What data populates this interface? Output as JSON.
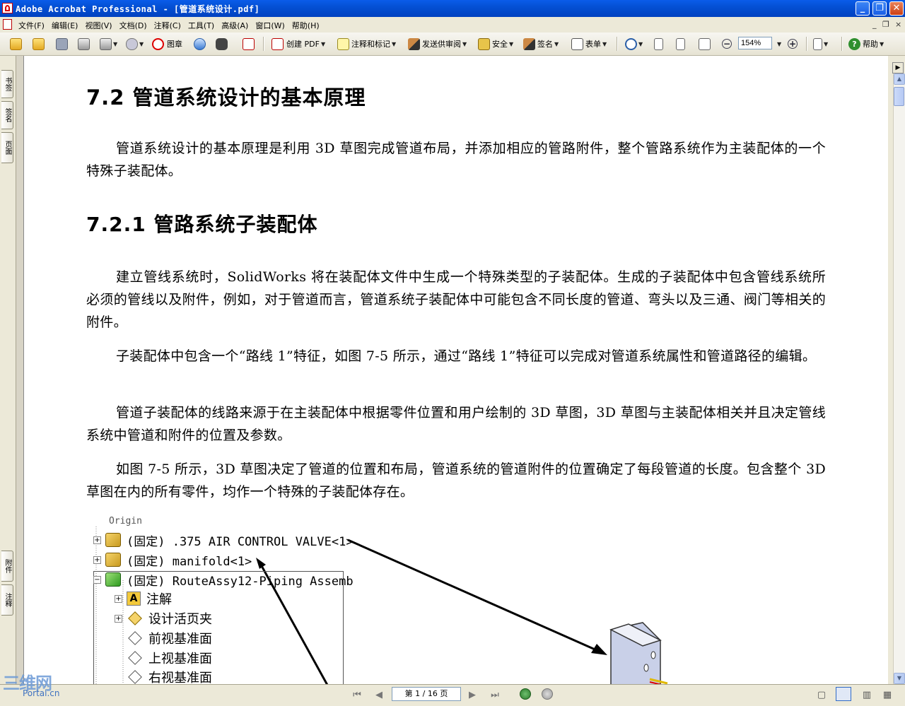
{
  "window": {
    "title": "Adobe Acrobat Professional - [管道系统设计.pdf]",
    "minimize": "_",
    "restore": "❐",
    "close": "✕"
  },
  "menubar": {
    "items": [
      "文件(F)",
      "编辑(E)",
      "视图(V)",
      "文档(D)",
      "注释(C)",
      "工具(T)",
      "高级(A)",
      "窗口(W)",
      "帮助(H)"
    ],
    "mdi_min": "_",
    "mdi_restore": "❐",
    "mdi_close": "×"
  },
  "toolbar": {
    "stamp_label": "图章",
    "create_pdf_label": "创建 PDF",
    "comment_label": "注释和标记",
    "review_label": "发送供审阅",
    "security_label": "安全",
    "sign_label": "签名",
    "forms_label": "表单",
    "zoom_value": "154%",
    "help_label": "帮助"
  },
  "left_tabs": {
    "bookmarks": "书签",
    "signatures": "签名",
    "pages": "页面",
    "attachments": "附件",
    "comments": "注释"
  },
  "document": {
    "heading": "7.2 管道系统设计的基本原理",
    "intro": "管道系统设计的基本原理是利用 3D 草图完成管道布局，并添加相应的管路附件，整个管路系统作为主装配体的一个特殊子装配体。",
    "subheading": "7.2.1 管路系统子装配体",
    "paragraphs": [
      "建立管线系统时，SolidWorks 将在装配体文件中生成一个特殊类型的子装配体。生成的子装配体中包含管线系统所必须的管线以及附件，例如，对于管道而言，管道系统子装配体中可能包含不同长度的管道、弯头以及三通、阀门等相关的附件。",
      "子装配体中包含一个“路线 1”特征，如图 7-5 所示，通过“路线 1”特征可以完成对管道系统属性和管道路径的编辑。",
      "管道子装配体的线路来源于在主装配体中根据零件位置和用户绘制的 3D 草图，3D 草图与主装配体相关并且决定管线系统中管道和附件的位置及参数。",
      "如图 7-5 所示，3D 草图决定了管道的位置和布局，管道系统的管道附件的位置确定了每段管道的长度。包含整个 3D 草图在内的所有零件，均作一个特殊的子装配体存在。"
    ]
  },
  "figure": {
    "origin_label": "Origin",
    "rows": [
      {
        "label": "(固定) .375 AIR CONTROL VALVE<1>"
      },
      {
        "label": "(固定) manifold<1>"
      },
      {
        "label": "(固定) RouteAssy12-Piping Assemb"
      },
      {
        "label": "注解"
      },
      {
        "label": "设计活页夹"
      },
      {
        "label": "前视基准面"
      },
      {
        "label": "上视基准面"
      },
      {
        "label": "右视基准面"
      }
    ]
  },
  "statusbar": {
    "page_indicator": "第 1 / 16 页"
  },
  "watermark": {
    "big": "三维网",
    "small": "Portal.cn"
  },
  "colors": {
    "titlebar": "#0a5ce9",
    "chrome": "#ece9d8",
    "page": "#ffffff"
  }
}
